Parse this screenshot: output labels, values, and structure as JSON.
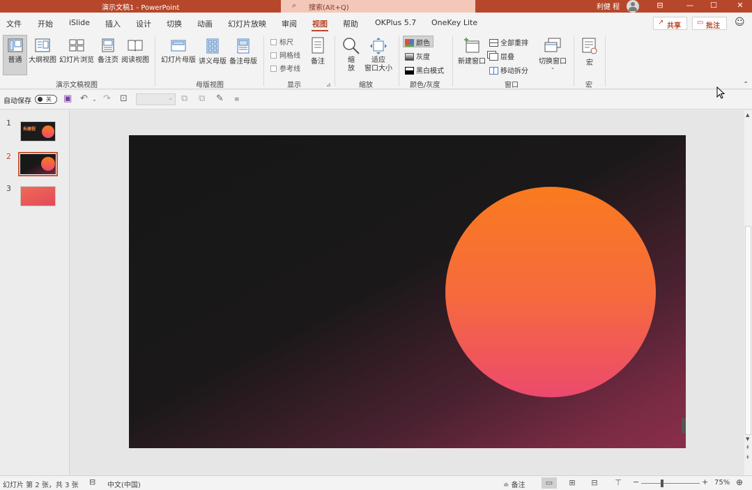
{
  "titlebar": {
    "title": "演示文稿1  -  PowerPoint",
    "search_placeholder": "搜索(Alt+Q)",
    "user": "利健 程",
    "minimize": "—",
    "maximize": "☐",
    "close": "✕",
    "ribbon_display": "⊟"
  },
  "tabs": [
    "文件",
    "开始",
    "iSlide",
    "插入",
    "设计",
    "切换",
    "动画",
    "幻灯片放映",
    "审阅",
    "视图",
    "帮助",
    "OKPlus 5.7",
    "OneKey Lite"
  ],
  "active_tab": "视图",
  "share": {
    "icon": "↗",
    "label": "共享"
  },
  "comment": {
    "icon": "▭",
    "label": "批注"
  },
  "ribbon": {
    "presentation_views": {
      "label": "演示文稿视图",
      "buttons": [
        "普通",
        "大纲视图",
        "幻灯片浏览",
        "备注页",
        "阅读视图"
      ]
    },
    "master_views": {
      "label": "母版视图",
      "buttons": [
        "幻灯片母版",
        "讲义母版",
        "备注母版"
      ]
    },
    "show": {
      "label": "显示",
      "checkboxes": [
        "标尺",
        "网格线",
        "参考线"
      ],
      "notes": "备注"
    },
    "zoom": {
      "label": "缩放",
      "zoom_btn_line1": "缩",
      "zoom_btn_line2": "放",
      "fit_line1": "适应",
      "fit_line2": "窗口大小"
    },
    "color": {
      "label": "颜色/灰度",
      "items": [
        "颜色",
        "灰度",
        "黑白模式"
      ]
    },
    "window": {
      "label": "窗口",
      "new_window": "新建窗口",
      "items": [
        "全部重排",
        "层叠",
        "移动拆分"
      ],
      "switch": "切换窗口"
    },
    "macros": {
      "label": "宏",
      "button": "宏"
    }
  },
  "qat": {
    "autosave_label": "自动保存",
    "autosave_state": "关"
  },
  "slides": [
    {
      "num": "1",
      "title_text": "朱建程"
    },
    {
      "num": "2"
    },
    {
      "num": "3"
    }
  ],
  "status": {
    "slide_info": "幻灯片 第 2 张，共 3 张",
    "language": "中文(中国)",
    "notes": "备注",
    "zoom_minus": "−",
    "zoom_plus": "+",
    "zoom_level": "75%"
  },
  "colors": {
    "accent": "#b7472a",
    "sun_top": "#f97a1f",
    "sun_bottom": "#ec4a6d",
    "slide_dark": "#171717",
    "slide_corner": "#8a2e4a"
  }
}
